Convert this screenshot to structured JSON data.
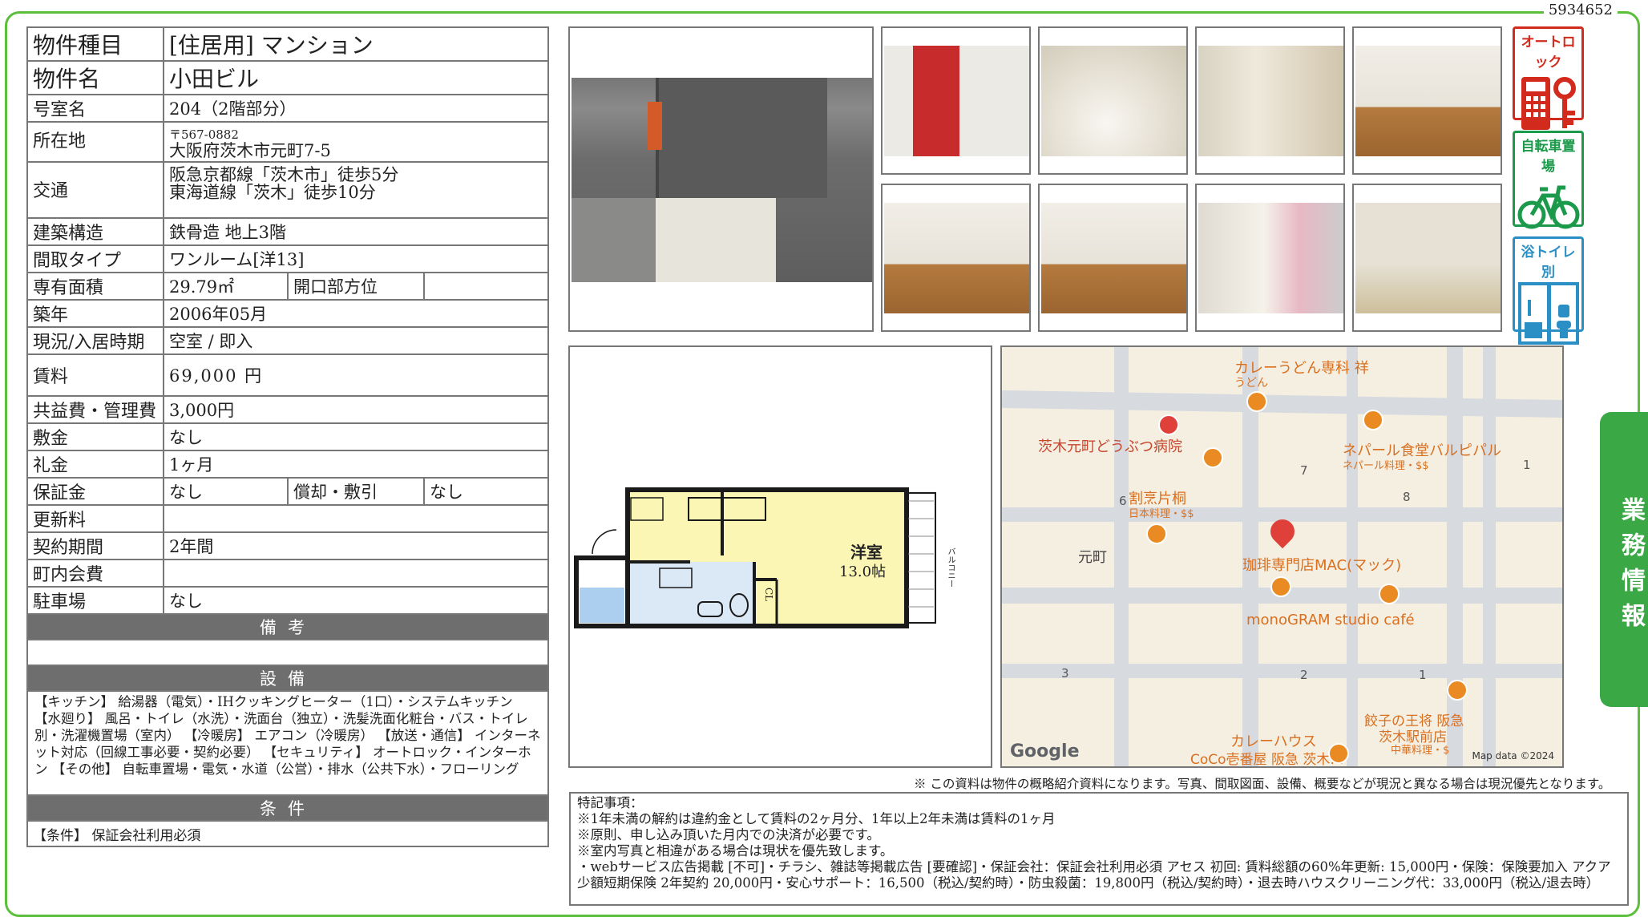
{
  "doc_id": "5934652",
  "spec": {
    "type_label": "物件種目",
    "type_value": "[住居用]  マンション",
    "name_label": "物件名",
    "name_value": "小田ビル",
    "room_label": "号室名",
    "room_value": "204（2階部分）",
    "address_label": "所在地",
    "postal": "〒567-0882",
    "address": "大阪府茨木市元町7-5",
    "access_label": "交通",
    "access_1": "阪急京都線「茨木市」徒歩5分",
    "access_2": "東海道線「茨木」徒歩10分",
    "structure_label": "建築構造",
    "structure_value": "鉄骨造 地上3階",
    "layout_label": "間取タイプ",
    "layout_value": "ワンルーム[洋13]",
    "area_label": "専有面積",
    "area_value": "29.79㎡",
    "direction_label": "開口部方位",
    "direction_value": "",
    "built_label": "築年",
    "built_value": "2006年05月",
    "status_label": "現況/入居時期",
    "status_value": "空室 / 即入",
    "rent_label": "賃料",
    "rent_value": "69,000 円",
    "fee_label": "共益費・管理費",
    "fee_value": "3,000円",
    "deposit_label": "敷金",
    "deposit_value": "なし",
    "keymoney_label": "礼金",
    "keymoney_value": "1ヶ月",
    "guarantee_label": "保証金",
    "guarantee_value": "なし",
    "amort_label": "償却・敷引",
    "amort_value": "なし",
    "renewal_label": "更新料",
    "renewal_value": "",
    "contract_label": "契約期間",
    "contract_value": "2年間",
    "assoc_label": "町内会費",
    "assoc_value": "",
    "parking_label": "駐車場",
    "parking_value": "なし",
    "memo_header": "備考",
    "equip_header": "設備",
    "equip_text": "【キッチン】 給湯器（電気）・IHクッキングヒーター（1口）・システムキッチン 【水廻り】 風呂・トイレ（水洗）・洗面台（独立）・洗髪洗面化粧台・バス・トイレ別・洗濯機置場（室内） 【冷暖房】 エアコン（冷暖房） 【放送・通信】 インターネット対応（回線工事必要・契約必要） 【セキュリティ】 オートロック・インターホン 【その他】 自転車置場・電気・水道（公営）・排水（公共下水）・フローリング",
    "cond_header": "条件",
    "cond_text": "【条件】 保証会社利用必須"
  },
  "badges": {
    "autolock": "オートロック",
    "bike": "自転車置場",
    "separate": "浴トイレ別"
  },
  "side_tab": "業務情報",
  "floorplan": {
    "room_label": "洋室",
    "room_size": "13.0帖",
    "balcony": "バルコニー",
    "cl": "CL"
  },
  "map": {
    "labels": {
      "curry_udon": "カレーうどん専科 祥",
      "udon": "うどん",
      "vet": "茨木元町どうぶつ病院",
      "nepal": "ネパール食堂バルピパル",
      "nepal_sub": "ネパール料理・$$",
      "kappo": "割烹片桐",
      "kappo_sub": "日本料理・$$",
      "motomachi": "元町",
      "mac": "珈琲専門店MAC(マック)",
      "monogram": "monoGRAM studio café",
      "gyoza": "餃子の王将 阪急",
      "gyoza_2": "茨木駅前店",
      "gyoza_sub": "中華料理・$",
      "coco_1": "カレーハウス",
      "coco_2": "CoCo壱番屋 阪急 茨木…",
      "n1": "1",
      "n7": "7",
      "n8": "8",
      "n6": "6",
      "n3": "3",
      "n2": "2",
      "n1b": "1"
    },
    "google": "Google",
    "map_data": "Map data ©2024"
  },
  "notice": "※ この資料は物件の概略紹介資料になります。写真、間取図面、設備、概要などが現況と異なる場合は現況優先となります。",
  "notes": {
    "title": "特記事項：",
    "line1": "※1年未満の解約は違約金として賃料の2ヶ月分、1年以上2年未満は賃料の1ヶ月",
    "line2": "※原則、申し込み頂いた月内での決済が必要です。",
    "line3": "※室内写真と相違がある場合は現状を優先致します。",
    "line4": "・webサービス広告掲載 [不可]・チラシ、雑誌等掲載広告 [要確認]・保証会社：保証会社利用必須 アセス 初回: 賃料総額の60%年更新: 15,000円・保険：保険要加入 アクア少額短期保険 2年契約 20,000円・安心サポート：16,500（税込/契約時）・防虫殺菌：19,800円（税込/契約時）・退去時ハウスクリーニング代：33,000円（税込/退去時）"
  }
}
